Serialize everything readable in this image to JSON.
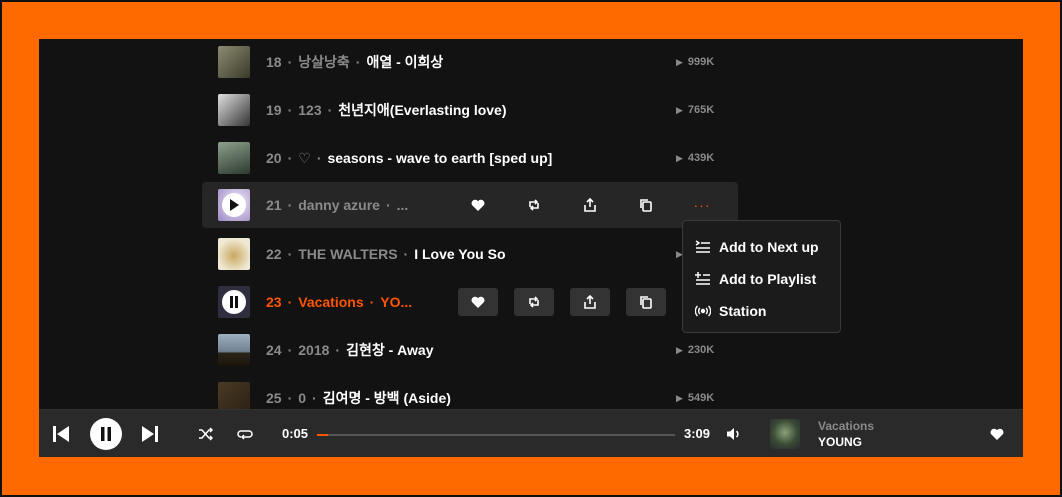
{
  "tracks": [
    {
      "num": "18",
      "artist": "낭살낭축",
      "title": "애열 - 이희상",
      "plays": "999K",
      "art": [
        "#6a6a5a",
        "#2f3a2a"
      ]
    },
    {
      "num": "19",
      "artist": "123",
      "title": "천년지애(Everlasting love)",
      "plays": "765K",
      "art": [
        "#ddd",
        "#444"
      ]
    },
    {
      "num": "20",
      "artist": "♡",
      "title": "seasons - wave to earth [sped up]",
      "plays": "439K",
      "art": [
        "#7a8c7a",
        "#3b4a3e"
      ]
    },
    {
      "num": "21",
      "artist": "danny azure",
      "title": "...",
      "plays": "",
      "art": [
        "#d8c8e8",
        "#8a78b0"
      ]
    },
    {
      "num": "22",
      "artist": "THE WALTERS",
      "title": "I Love You So",
      "plays": "",
      "art": [
        "#e8e0c8",
        "#b0a070"
      ]
    },
    {
      "num": "23",
      "artist": "Vacations",
      "title": "YO...",
      "plays": "",
      "art": [
        "#3a3a4a",
        "#222"
      ]
    },
    {
      "num": "24",
      "artist": "2018",
      "title": "김현창 - Away",
      "plays": "230K",
      "art": [
        "#8aa0b0",
        "#3a3020"
      ]
    },
    {
      "num": "25",
      "artist": "0",
      "title": "김여명 - 방백 (Aside)",
      "plays": "549K",
      "art": [
        "#3a3020",
        "#6a5030"
      ]
    }
  ],
  "menu": {
    "items": [
      {
        "label": "Add to Next up",
        "icon": "next-up-icon"
      },
      {
        "label": "Add to Playlist",
        "icon": "playlist-add-icon"
      },
      {
        "label": "Station",
        "icon": "station-icon"
      }
    ]
  },
  "player": {
    "elapsed": "0:05",
    "duration": "3:09",
    "progress": 0.03,
    "artist": "Vacations",
    "title": "YOUNG"
  },
  "colors": {
    "accent": "#ff5500",
    "frame": "#ff6a00"
  }
}
